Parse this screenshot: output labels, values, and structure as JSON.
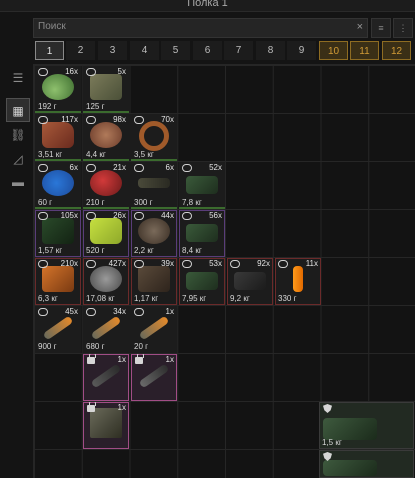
{
  "window": {
    "title": "Полка 1"
  },
  "search": {
    "placeholder": "Поиск",
    "clear": "×"
  },
  "toolbar": {
    "btn1": "≡",
    "btn2": "⋮"
  },
  "page_tabs": [
    {
      "label": "1",
      "state": "active"
    },
    {
      "label": "2",
      "state": "normal"
    },
    {
      "label": "3",
      "state": "normal"
    },
    {
      "label": "4",
      "state": "normal"
    },
    {
      "label": "5",
      "state": "normal"
    },
    {
      "label": "6",
      "state": "normal"
    },
    {
      "label": "7",
      "state": "normal"
    },
    {
      "label": "8",
      "state": "normal"
    },
    {
      "label": "9",
      "state": "normal"
    },
    {
      "label": "10",
      "state": "locked"
    },
    {
      "label": "11",
      "state": "locked"
    },
    {
      "label": "12",
      "state": "locked"
    }
  ],
  "sidebar": [
    {
      "icon": "list-icon",
      "active": false
    },
    {
      "icon": "grid-icon",
      "active": true
    },
    {
      "icon": "link-icon",
      "active": false
    },
    {
      "icon": "ruler-icon",
      "active": false
    },
    {
      "icon": "archive-icon",
      "active": false
    }
  ],
  "items": [
    {
      "qty": "16x",
      "wt": "192 г"
    },
    {
      "qty": "5x",
      "wt": "125 г"
    },
    {
      "qty": "117x",
      "wt": "3,51 кг"
    },
    {
      "qty": "98x",
      "wt": "4,4 кг"
    },
    {
      "qty": "70x",
      "wt": "3,5 кг"
    },
    {
      "qty": "6x",
      "wt": "60 г"
    },
    {
      "qty": "21x",
      "wt": "210 г"
    },
    {
      "qty": "6x",
      "wt": "300 г"
    },
    {
      "qty": "52x",
      "wt": "7,8 кг"
    },
    {
      "qty": "105x",
      "wt": "1,57 кг"
    },
    {
      "qty": "26x",
      "wt": "520 г"
    },
    {
      "qty": "44x",
      "wt": "2,2 кг"
    },
    {
      "qty": "56x",
      "wt": "8,4 кг"
    },
    {
      "qty": "210x",
      "wt": "6,3 кг"
    },
    {
      "qty": "427x",
      "wt": "17,08 кг"
    },
    {
      "qty": "39x",
      "wt": "1,17 кг"
    },
    {
      "qty": "53x",
      "wt": "7,95 кг"
    },
    {
      "qty": "92x",
      "wt": "9,2 кг"
    },
    {
      "qty": "11x",
      "wt": "330 г"
    },
    {
      "qty": "45x",
      "wt": "900 г"
    },
    {
      "qty": "34x",
      "wt": "680 г"
    },
    {
      "qty": "1x",
      "wt": "20 г"
    },
    {
      "qty": "1x",
      "wt": ""
    },
    {
      "qty": "1x",
      "wt": ""
    },
    {
      "qty": "1x",
      "wt": ""
    }
  ],
  "big_items": [
    {
      "wt": "1,5 кг"
    },
    {
      "wt": ""
    }
  ],
  "colors": {
    "accent_locked": "#d19b36",
    "selection": "#a14d86"
  }
}
